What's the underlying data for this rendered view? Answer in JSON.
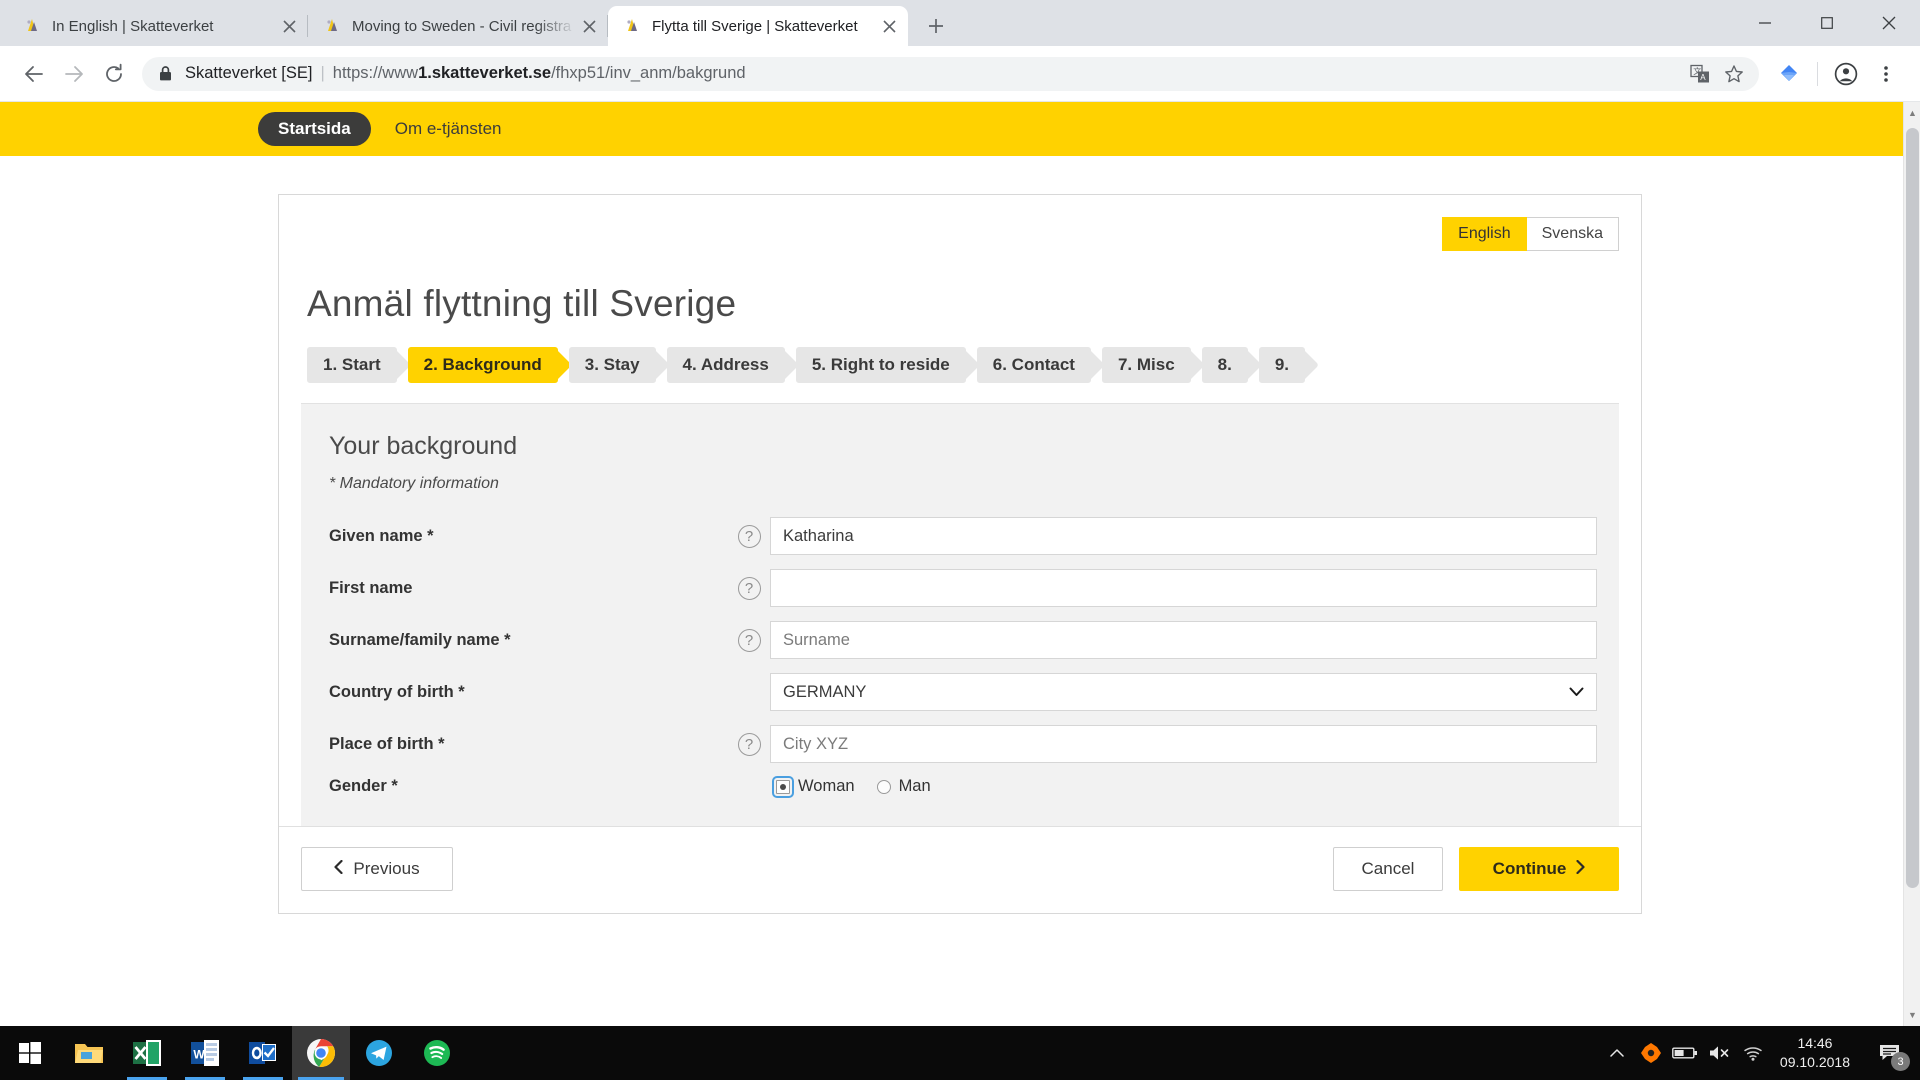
{
  "browser": {
    "tabs": [
      {
        "title": "In English | Skatteverket",
        "favicon": "skatteverket-icon",
        "active": false
      },
      {
        "title": "Moving to Sweden - Civil registra",
        "favicon": "skatteverket-icon",
        "active": false
      },
      {
        "title": "Flytta till Sverige | Skatteverket",
        "favicon": "skatteverket-icon",
        "active": true
      }
    ],
    "new_tab_label": "+",
    "window_controls": {
      "minimize": "minimize-icon",
      "maximize": "maximize-icon",
      "close": "close-icon"
    },
    "nav": {
      "back": "back-arrow-icon",
      "forward": "forward-arrow-icon",
      "reload": "reload-icon"
    },
    "omnibox": {
      "lock": "lock-icon",
      "security_label": "Skatteverket [SE]",
      "separator": "|",
      "url_prefix": "https://www",
      "url_domain": "1.skatteverket.se",
      "url_path": "/fhxp51/inv_anm/bakgrund",
      "translate": "translate-icon",
      "bookmark": "star-icon"
    },
    "extension_icon": "extension-diamond-icon",
    "profile_icon": "profile-avatar-icon",
    "menu_icon": "three-dot-menu-icon"
  },
  "site": {
    "header": {
      "home_label": "Startsida",
      "about_label": "Om e-tjänsten",
      "bar_color": "#ffd200"
    },
    "language": {
      "english": "English",
      "swedish": "Svenska",
      "selected": "English"
    },
    "page_title": "Anmäl flyttning till Sverige",
    "steps": [
      {
        "label": "1. Start",
        "active": false
      },
      {
        "label": "2. Background",
        "active": true
      },
      {
        "label": "3. Stay",
        "active": false
      },
      {
        "label": "4. Address",
        "active": false
      },
      {
        "label": "5. Right to reside",
        "active": false
      },
      {
        "label": "6. Contact",
        "active": false
      },
      {
        "label": "7. Misc",
        "active": false
      },
      {
        "label": "8.",
        "active": false
      },
      {
        "label": "9.",
        "active": false
      }
    ],
    "form": {
      "section_title": "Your background",
      "mandatory_note": "* Mandatory information",
      "help_glyph": "?",
      "fields": [
        {
          "label": "Given name *",
          "help": true,
          "type": "text",
          "value": "Katharina",
          "is_placeholder": false
        },
        {
          "label": "First name",
          "help": true,
          "type": "text",
          "value": "",
          "is_placeholder": false
        },
        {
          "label": "Surname/family name *",
          "help": true,
          "type": "text",
          "value": "Surname",
          "is_placeholder": true
        },
        {
          "label": "Country of birth *",
          "help": false,
          "type": "select",
          "value": "GERMANY",
          "caret": "▼"
        },
        {
          "label": "Place of birth *",
          "help": true,
          "type": "text",
          "value": "City XYZ",
          "is_placeholder": true
        }
      ],
      "gender": {
        "label": "Gender *",
        "options": [
          {
            "label": "Woman",
            "checked": true,
            "focused": true
          },
          {
            "label": "Man",
            "checked": false,
            "focused": false
          }
        ]
      }
    },
    "footer": {
      "previous": "Previous",
      "previous_icon": "chevron-left-icon",
      "cancel": "Cancel",
      "continue": "Continue",
      "continue_icon": "chevron-right-icon"
    },
    "accent_color": "#ffd200"
  },
  "taskbar": {
    "start": "windows-start-icon",
    "items": [
      {
        "name": "file-explorer-icon"
      },
      {
        "name": "excel-icon"
      },
      {
        "name": "word-icon"
      },
      {
        "name": "outlook-icon"
      },
      {
        "name": "chrome-icon"
      },
      {
        "name": "telegram-icon"
      },
      {
        "name": "spotify-icon"
      }
    ],
    "tray": {
      "show_hidden": "chevron-up-icon",
      "antivirus": "avast-icon",
      "battery": "battery-icon",
      "volume": "volume-muted-icon",
      "network": "wifi-icon",
      "time": "14:46",
      "date": "09.10.2018",
      "notifications": "notification-icon",
      "notification_count": "3"
    }
  }
}
